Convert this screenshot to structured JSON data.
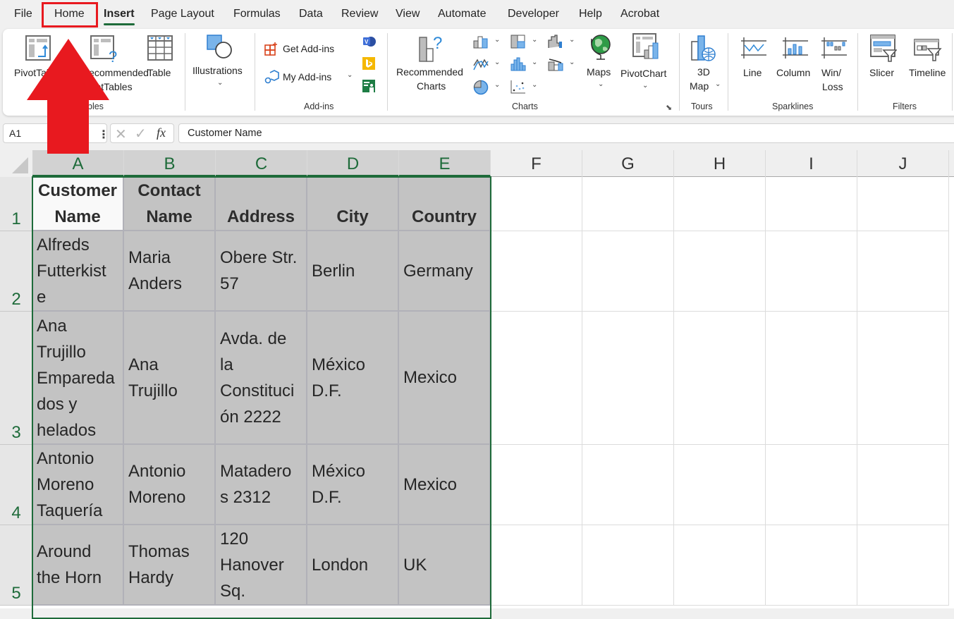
{
  "menu_tabs": [
    {
      "label": "File"
    },
    {
      "label": "Home"
    },
    {
      "label": "Insert"
    },
    {
      "label": "Page Layout"
    },
    {
      "label": "Formulas"
    },
    {
      "label": "Data"
    },
    {
      "label": "Review"
    },
    {
      "label": "View"
    },
    {
      "label": "Automate"
    },
    {
      "label": "Developer"
    },
    {
      "label": "Help"
    },
    {
      "label": "Acrobat"
    }
  ],
  "active_tab": "Insert",
  "highlighted_tab": "Home",
  "annotation": {
    "color": "#e8191f",
    "type": "arrow-up",
    "target": "Home"
  },
  "ribbon": {
    "tables": {
      "group": "Tables",
      "visible_group_label": "bles",
      "pivottable": "PivotTable",
      "rec_pivot_line1": "Recommended",
      "rec_pivot_line2": "PivotTables",
      "table": "Table"
    },
    "illustrations": {
      "label": "Illustrations"
    },
    "addins": {
      "group": "Add-ins",
      "get": "Get Add-ins",
      "my": "My Add-ins"
    },
    "charts": {
      "group": "Charts",
      "rec_line1": "Recommended",
      "rec_line2": "Charts",
      "maps": "Maps",
      "pivotchart": "PivotChart"
    },
    "tours": {
      "group": "Tours",
      "line1": "3D",
      "line2": "Map"
    },
    "sparklines": {
      "group": "Sparklines",
      "line": "Line",
      "column": "Column",
      "winloss_line1": "Win/",
      "winloss_line2": "Loss"
    },
    "filters": {
      "group": "Filters",
      "slicer": "Slicer",
      "timeline": "Timeline"
    }
  },
  "formula_bar": {
    "name_box": "A1",
    "fx": "fx",
    "value": "Customer Name"
  },
  "columns": [
    "A",
    "B",
    "C",
    "D",
    "E",
    "F",
    "G",
    "H",
    "I",
    "J"
  ],
  "rows": [
    "1",
    "2",
    "3",
    "4",
    "5"
  ],
  "table": {
    "headers": [
      [
        "Customer",
        "Name"
      ],
      [
        "Contact",
        "Name"
      ],
      [
        "Address"
      ],
      [
        "City"
      ],
      [
        "Country"
      ]
    ],
    "data": [
      [
        [
          "Alfreds",
          "Futterkist",
          "e"
        ],
        [
          "Maria",
          "Anders"
        ],
        [
          "Obere Str.",
          "57"
        ],
        [
          "Berlin"
        ],
        [
          "Germany"
        ]
      ],
      [
        [
          "Ana",
          "Trujillo",
          "Empareda",
          "dos y",
          "helados"
        ],
        [
          "Ana",
          "Trujillo"
        ],
        [
          "Avda. de",
          "la",
          "Constituci",
          "ón 2222"
        ],
        [
          "México",
          "D.F."
        ],
        [
          "Mexico"
        ]
      ],
      [
        [
          "Antonio",
          "Moreno",
          "Taquería"
        ],
        [
          "Antonio",
          "Moreno"
        ],
        [
          "Matadero",
          "s 2312"
        ],
        [
          "México",
          "D.F."
        ],
        [
          "Mexico"
        ]
      ],
      [
        [
          "Around",
          "the Horn"
        ],
        [
          "Thomas",
          "Hardy"
        ],
        [
          "120",
          "Hanover",
          "Sq."
        ],
        [
          "London"
        ],
        [
          "UK"
        ]
      ]
    ]
  },
  "colors": {
    "accent_green": "#1e6b3a",
    "selection_fill": "#c3c3c3",
    "annotation_red": "#e8191f"
  }
}
